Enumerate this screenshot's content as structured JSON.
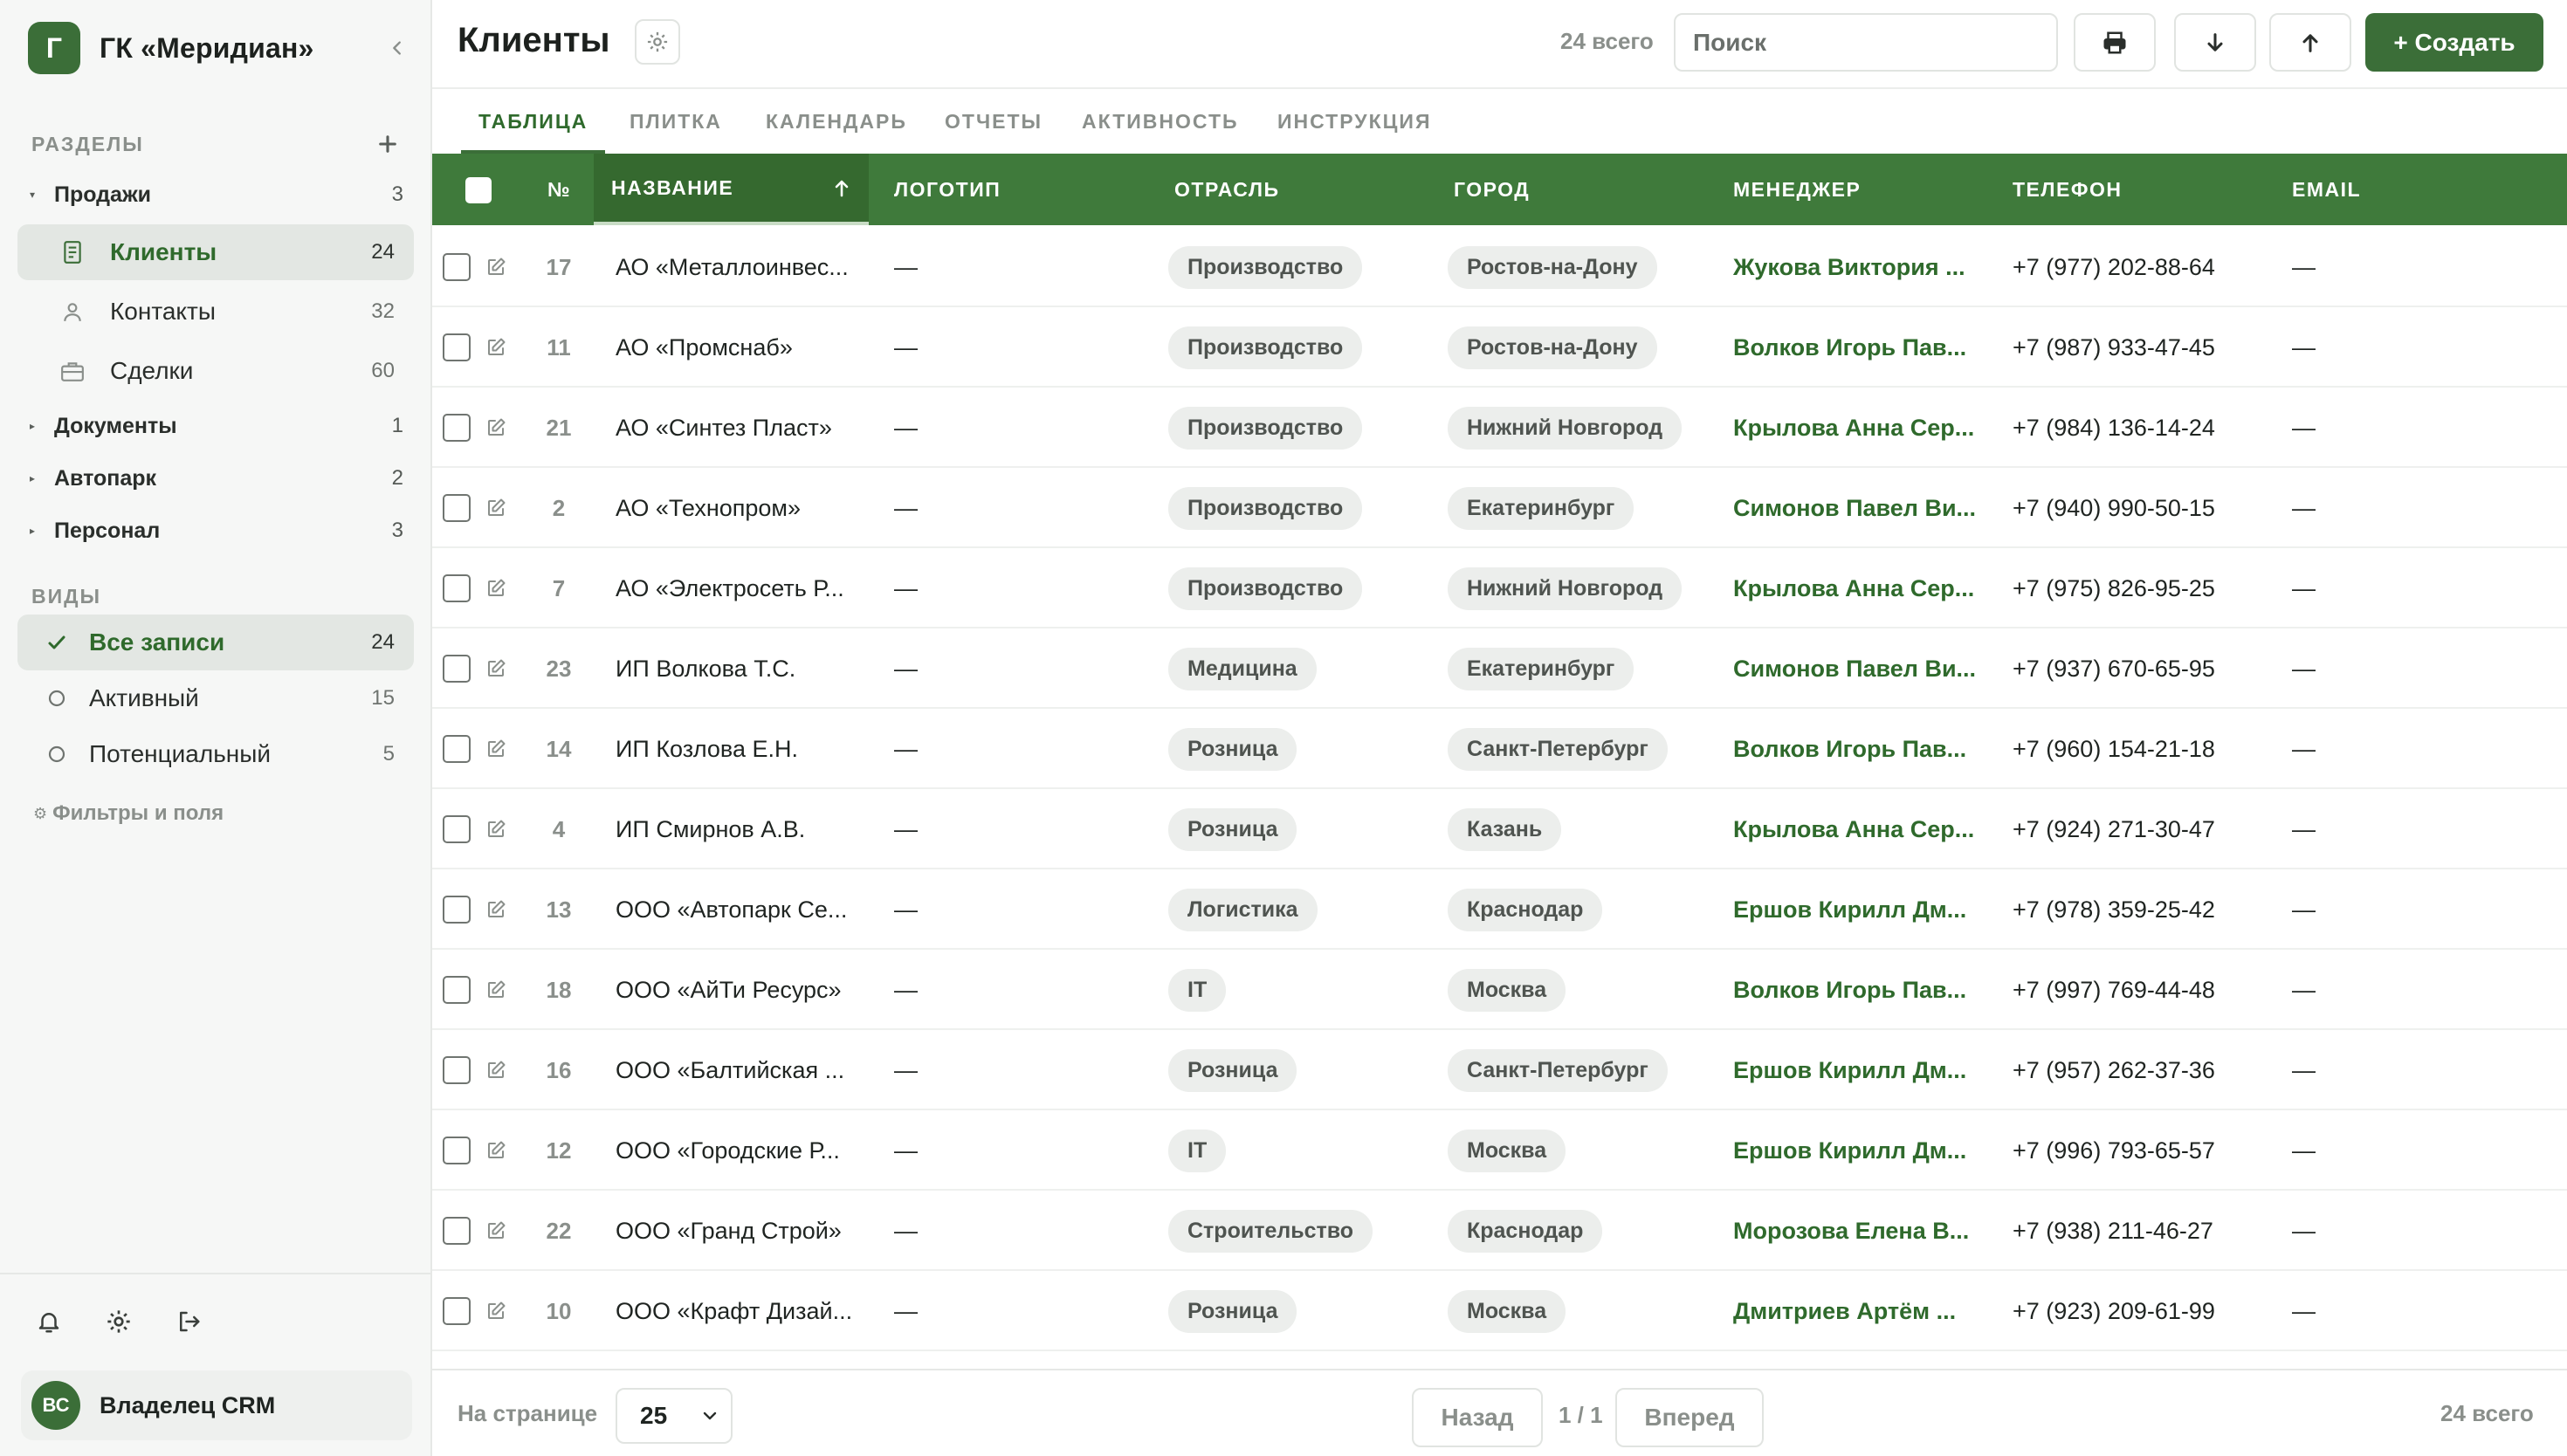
{
  "brand": {
    "logo_letter": "Г",
    "name": "ГК «Меридиан»"
  },
  "sidebar": {
    "sections_title": "РАЗДЕЛЫ",
    "groups": [
      {
        "label": "Продажи",
        "count": "3",
        "expanded": true,
        "items": [
          {
            "label": "Клиенты",
            "count": "24",
            "icon": "document-icon",
            "active": true
          },
          {
            "label": "Контакты",
            "count": "32",
            "icon": "person-icon",
            "active": false
          },
          {
            "label": "Сделки",
            "count": "60",
            "icon": "briefcase-icon",
            "active": false
          }
        ]
      },
      {
        "label": "Документы",
        "count": "1",
        "expanded": false
      },
      {
        "label": "Автопарк",
        "count": "2",
        "expanded": false
      },
      {
        "label": "Персонал",
        "count": "3",
        "expanded": false
      }
    ],
    "views_title": "ВИДЫ",
    "views": [
      {
        "label": "Все записи",
        "count": "24",
        "active": true
      },
      {
        "label": "Активный",
        "count": "15",
        "active": false
      },
      {
        "label": "Потенциальный",
        "count": "5",
        "active": false
      }
    ],
    "filters_link": "Фильтры и поля",
    "user": {
      "initials": "ВС",
      "name": "Владелец CRM"
    }
  },
  "header": {
    "title": "Клиенты",
    "total": "24 всего",
    "search_placeholder": "Поиск",
    "create_label": "+ Создать"
  },
  "tabs": [
    "ТАБЛИЦА",
    "ПЛИТКА",
    "КАЛЕНДАРЬ",
    "ОТЧЕТЫ",
    "АКТИВНОСТЬ",
    "ИНСТРУКЦИЯ"
  ],
  "table": {
    "columns": [
      "№",
      "НАЗВАНИЕ",
      "ЛОГОТИП",
      "ОТРАСЛЬ",
      "ГОРОД",
      "МЕНЕДЖЕР",
      "ТЕЛЕФОН",
      "EMAIL"
    ],
    "sorted_column": "НАЗВАНИЕ",
    "sort_direction": "asc",
    "rows": [
      {
        "num": "17",
        "name": "АО «Металлоинвес...",
        "logo": "—",
        "industry": "Производство",
        "city": "Ростов-на-Дону",
        "manager": "Жукова Виктория ...",
        "phone": "+7 (977) 202-88-64",
        "email": "—"
      },
      {
        "num": "11",
        "name": "АО «Промснаб»",
        "logo": "—",
        "industry": "Производство",
        "city": "Ростов-на-Дону",
        "manager": "Волков Игорь Пав...",
        "phone": "+7 (987) 933-47-45",
        "email": "—"
      },
      {
        "num": "21",
        "name": "АО «Синтез Пласт»",
        "logo": "—",
        "industry": "Производство",
        "city": "Нижний Новгород",
        "manager": "Крылова Анна Сер...",
        "phone": "+7 (984) 136-14-24",
        "email": "—"
      },
      {
        "num": "2",
        "name": "АО «Технопром»",
        "logo": "—",
        "industry": "Производство",
        "city": "Екатеринбург",
        "manager": "Симонов Павел Ви...",
        "phone": "+7 (940) 990-50-15",
        "email": "—"
      },
      {
        "num": "7",
        "name": "АО «Электросеть Р...",
        "logo": "—",
        "industry": "Производство",
        "city": "Нижний Новгород",
        "manager": "Крылова Анна Сер...",
        "phone": "+7 (975) 826-95-25",
        "email": "—"
      },
      {
        "num": "23",
        "name": "ИП Волкова Т.С.",
        "logo": "—",
        "industry": "Медицина",
        "city": "Екатеринбург",
        "manager": "Симонов Павел Ви...",
        "phone": "+7 (937) 670-65-95",
        "email": "—"
      },
      {
        "num": "14",
        "name": "ИП Козлова Е.Н.",
        "logo": "—",
        "industry": "Розница",
        "city": "Санкт-Петербург",
        "manager": "Волков Игорь Пав...",
        "phone": "+7 (960) 154-21-18",
        "email": "—"
      },
      {
        "num": "4",
        "name": "ИП Смирнов А.В.",
        "logo": "—",
        "industry": "Розница",
        "city": "Казань",
        "manager": "Крылова Анна Сер...",
        "phone": "+7 (924) 271-30-47",
        "email": "—"
      },
      {
        "num": "13",
        "name": "ООО «Автопарк Се...",
        "logo": "—",
        "industry": "Логистика",
        "city": "Краснодар",
        "manager": "Ершов Кирилл Дм...",
        "phone": "+7 (978) 359-25-42",
        "email": "—"
      },
      {
        "num": "18",
        "name": "ООО «АйТи Ресурс»",
        "logo": "—",
        "industry": "IT",
        "city": "Москва",
        "manager": "Волков Игорь Пав...",
        "phone": "+7 (997) 769-44-48",
        "email": "—"
      },
      {
        "num": "16",
        "name": "ООО «Балтийская ...",
        "logo": "—",
        "industry": "Розница",
        "city": "Санкт-Петербург",
        "manager": "Ершов Кирилл Дм...",
        "phone": "+7 (957) 262-37-36",
        "email": "—"
      },
      {
        "num": "12",
        "name": "ООО «Городские Р...",
        "logo": "—",
        "industry": "IT",
        "city": "Москва",
        "manager": "Ершов Кирилл Дм...",
        "phone": "+7 (996) 793-65-57",
        "email": "—"
      },
      {
        "num": "22",
        "name": "ООО «Гранд Строй»",
        "logo": "—",
        "industry": "Строительство",
        "city": "Краснодар",
        "manager": "Морозова Елена В...",
        "phone": "+7 (938) 211-46-27",
        "email": "—"
      },
      {
        "num": "10",
        "name": "ООО «Крафт Дизай...",
        "logo": "—",
        "industry": "Розница",
        "city": "Москва",
        "manager": "Дмитриев Артём ...",
        "phone": "+7 (923) 209-61-99",
        "email": "—"
      }
    ]
  },
  "footer": {
    "per_page_label": "На странице",
    "per_page_value": "25",
    "prev_label": "Назад",
    "page_info": "1 / 1",
    "next_label": "Вперед",
    "total": "24 всего"
  },
  "colors": {
    "accent": "#3b6e38",
    "header_bg": "#3f7a3b",
    "manager_text": "#2f6a2c",
    "sidebar_bg": "#f6f7f6"
  }
}
